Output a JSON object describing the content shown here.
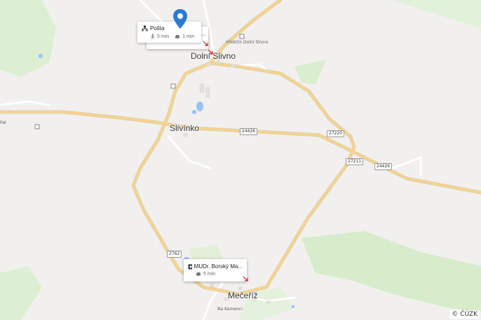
{
  "places": {
    "dolni_slivno": "Dolní Slivno",
    "slivinko": "Slivínko",
    "mecerize": "Mečeříž",
    "hrebcin": "Hřebčín Dolní Slivno",
    "na_kamenci": "Na Kamenci",
    "pal": "Pal"
  },
  "roads": {
    "r24426a": "24426",
    "r27220": "27220",
    "r27211": "27211",
    "r24426b": "24426",
    "r2762": "2762"
  },
  "cards": {
    "posta": {
      "title": "Pošta",
      "walk": "5 min",
      "drive": "1 min"
    },
    "behind": {
      "title": "..."
    },
    "doctor": {
      "title": "MUDr. Borský Ma...",
      "drive": "5 min"
    }
  },
  "copyright": "© ČÚZK",
  "icons": {
    "marker": "map-pin-icon",
    "post": "post-office-icon",
    "medical": "medical-cross-icon",
    "walk": "walk-icon",
    "car": "car-icon"
  },
  "colors": {
    "land": "#f1f0ee",
    "green": "#d3ecc8",
    "water": "#9ac1f6",
    "road_main": "#f6d48c",
    "road_minor": "#ffffff",
    "pin": "#2a79d4"
  }
}
